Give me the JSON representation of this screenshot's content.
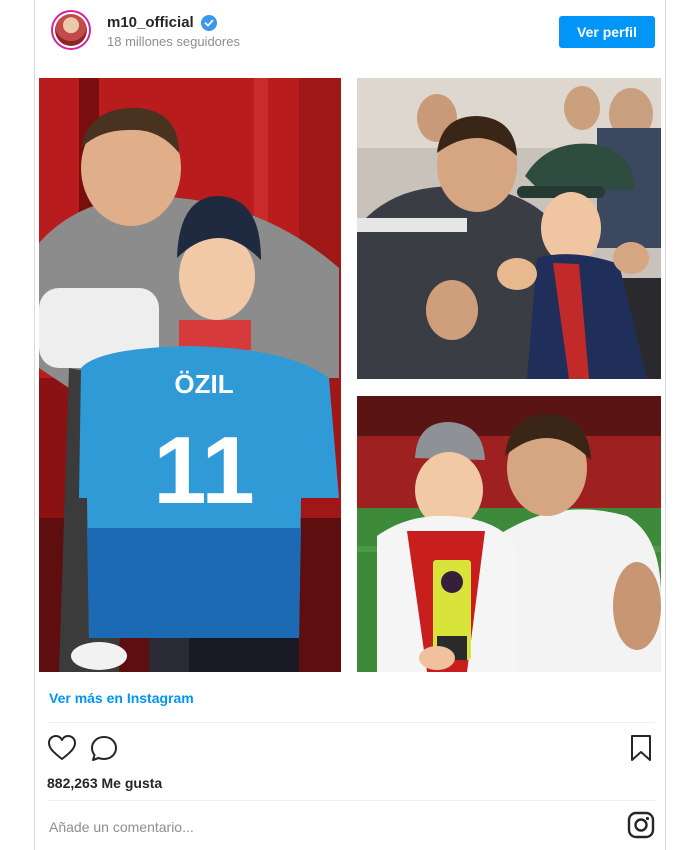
{
  "header": {
    "username": "m10_official",
    "followers": "18 millones seguidores",
    "profile_button": "Ver perfil"
  },
  "photos": {
    "main_shirt_name": "ÖZIL",
    "main_shirt_number": "11"
  },
  "post": {
    "view_more": "Ver más en Instagram",
    "likes": "882,263 Me gusta",
    "comment_placeholder": "Añade un comentario..."
  },
  "icons": [
    "verified-icon",
    "heart-icon",
    "comment-icon",
    "bookmark-icon",
    "instagram-icon"
  ],
  "colors": {
    "accent": "#0095f6",
    "verified": "#3897f0"
  }
}
